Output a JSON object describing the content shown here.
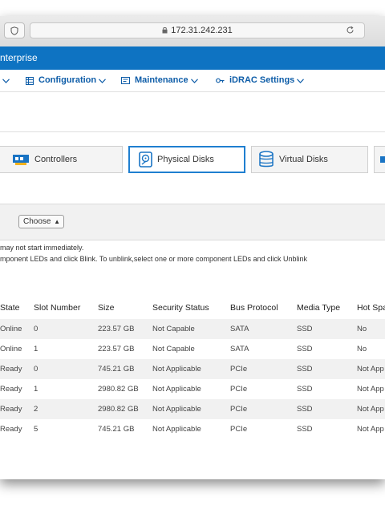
{
  "browser": {
    "url": "172.31.242.231"
  },
  "header": {
    "brand_fragment": "nterprise"
  },
  "nav": {
    "items": [
      {
        "label": "Configuration"
      },
      {
        "label": "Maintenance"
      },
      {
        "label": "iDRAC Settings"
      }
    ]
  },
  "components": {
    "buttons": [
      {
        "label": "Controllers",
        "icon": "controller-card-icon"
      },
      {
        "label": "Physical Disks",
        "icon": "physical-disk-icon",
        "selected": true
      },
      {
        "label": "Virtual Disks",
        "icon": "virtual-disk-icon"
      }
    ]
  },
  "filter": {
    "select_value": "Choose"
  },
  "messages": {
    "line1": " may not start immediately.",
    "line2": "mponent LEDs and click Blink. To unblink,select one or more component LEDs and click Unblink"
  },
  "table": {
    "columns": [
      "State",
      "Slot Number",
      "Size",
      "Security Status",
      "Bus Protocol",
      "Media Type",
      "Hot Spa"
    ],
    "rows": [
      [
        "Online",
        "0",
        "223.57 GB",
        "Not Capable",
        "SATA",
        "SSD",
        "No"
      ],
      [
        "Online",
        "1",
        "223.57 GB",
        "Not Capable",
        "SATA",
        "SSD",
        "No"
      ],
      [
        "Ready",
        "0",
        "745.21 GB",
        "Not Applicable",
        "PCIe",
        "SSD",
        "Not App"
      ],
      [
        "Ready",
        "1",
        "2980.82 GB",
        "Not Applicable",
        "PCIe",
        "SSD",
        "Not App"
      ],
      [
        "Ready",
        "2",
        "2980.82 GB",
        "Not Applicable",
        "PCIe",
        "SSD",
        "Not App"
      ],
      [
        "Ready",
        "5",
        "745.21 GB",
        "Not Applicable",
        "PCIe",
        "SSD",
        "Not App"
      ]
    ]
  },
  "colors": {
    "brand_blue": "#0e73c2",
    "nav_text": "#0e5da8",
    "selected_border": "#1f7fd0"
  }
}
